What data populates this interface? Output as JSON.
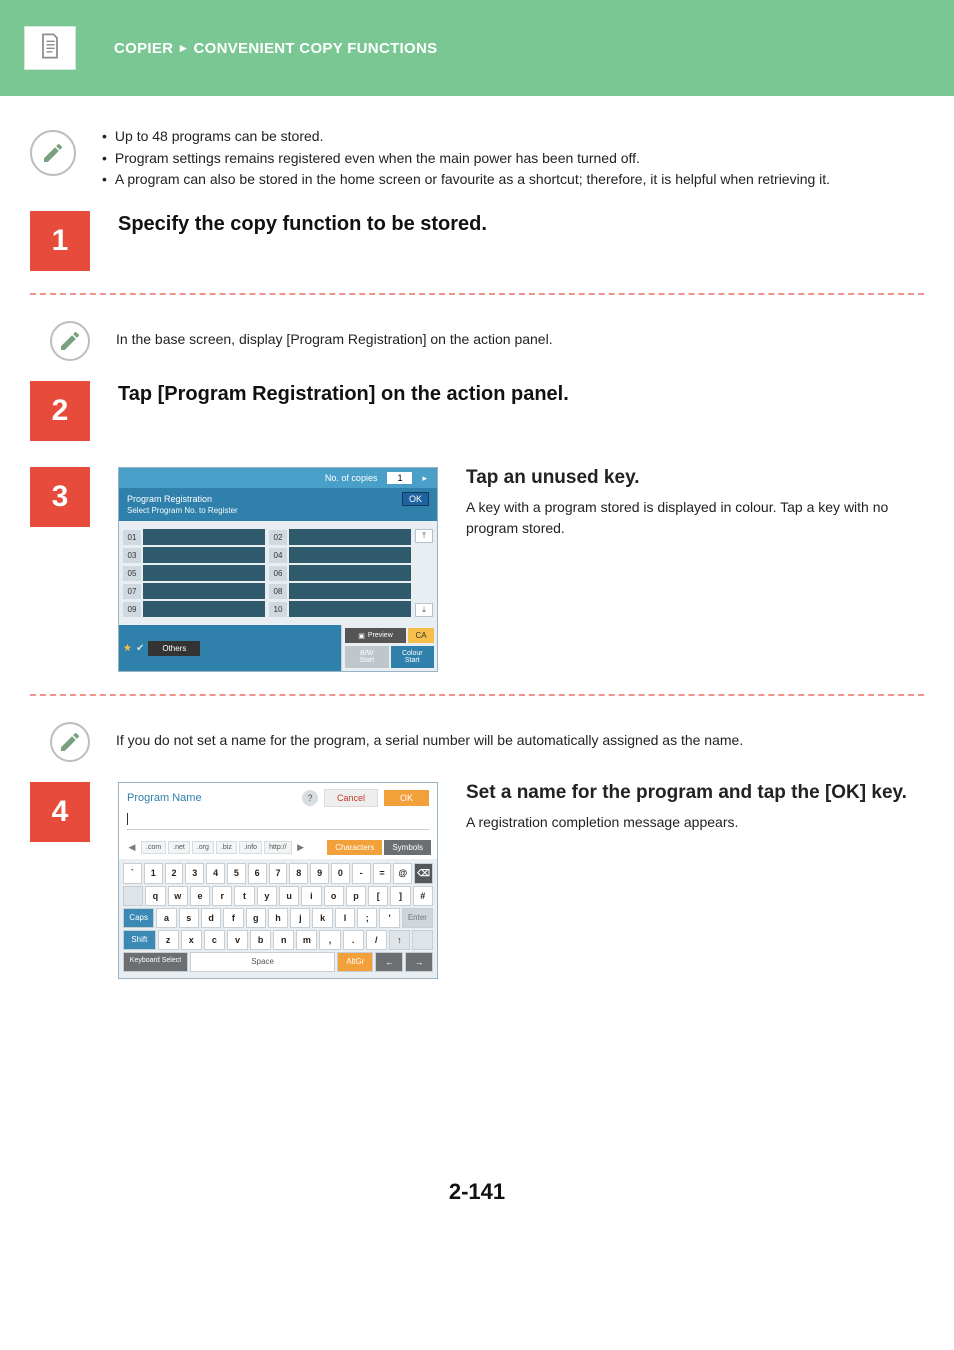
{
  "breadcrumb": {
    "section": "COPIER",
    "subsection": "CONVENIENT COPY FUNCTIONS"
  },
  "intro_bullets": [
    "Up to 48 programs can be stored.",
    "Program settings remains registered even when the main power has been turned off.",
    "A program can also be stored in the home screen or favourite as a shortcut; therefore, it is helpful when retrieving it."
  ],
  "steps": {
    "s1": {
      "num": "1",
      "title": "Specify the copy function to be stored.",
      "sub": "In the base screen, display [Program Registration] on the action panel."
    },
    "s2": {
      "num": "2",
      "title": "Tap [Program Registration] on the action panel."
    },
    "s3": {
      "num": "3",
      "title": "Tap an unused key.",
      "body": "A key with a program stored is displayed in colour. Tap a key with no program stored.",
      "sub": "If you do not set a name for the program, a serial number will be automatically assigned as the name."
    },
    "s4": {
      "num": "4",
      "title": "Set a name for the program and tap the [OK] key.",
      "body": "A registration completion message appears."
    }
  },
  "shot3": {
    "copies_label": "No. of copies",
    "copies_value": "1",
    "panel_title": "Program Registration",
    "panel_sub": "Select Program No. to Register",
    "ok": "OK",
    "indices_left": [
      "01",
      "03",
      "05",
      "07",
      "09"
    ],
    "indices_right": [
      "02",
      "04",
      "06",
      "08",
      "10"
    ],
    "others": "Others",
    "preview": "Preview",
    "ca": "CA",
    "bw_start_1": "B/W",
    "bw_start_2": "Start",
    "colour_start_1": "Colour",
    "colour_start_2": "Start"
  },
  "shot4": {
    "title": "Program Name",
    "cancel": "Cancel",
    "ok": "OK",
    "tabs": [
      ".com",
      ".net",
      ".org",
      ".biz",
      ".info",
      "http://"
    ],
    "characters": "Characters",
    "symbols": "Symbols",
    "row1": [
      "`",
      "1",
      "2",
      "3",
      "4",
      "5",
      "6",
      "7",
      "8",
      "9",
      "0",
      "-",
      "=",
      "@"
    ],
    "row2": [
      "q",
      "w",
      "e",
      "r",
      "t",
      "y",
      "u",
      "i",
      "o",
      "p",
      "[",
      "]",
      "#"
    ],
    "caps": "Caps",
    "row3": [
      "a",
      "s",
      "d",
      "f",
      "g",
      "h",
      "j",
      "k",
      "l",
      ";",
      "'"
    ],
    "enter": "Enter",
    "shift": "Shift",
    "row4": [
      "z",
      "x",
      "c",
      "v",
      "b",
      "n",
      "m",
      ",",
      ".",
      "/"
    ],
    "keyboard_select": "Keyboard Select",
    "space": "Space",
    "altgr": "AltGr"
  },
  "page_number": "2-141"
}
